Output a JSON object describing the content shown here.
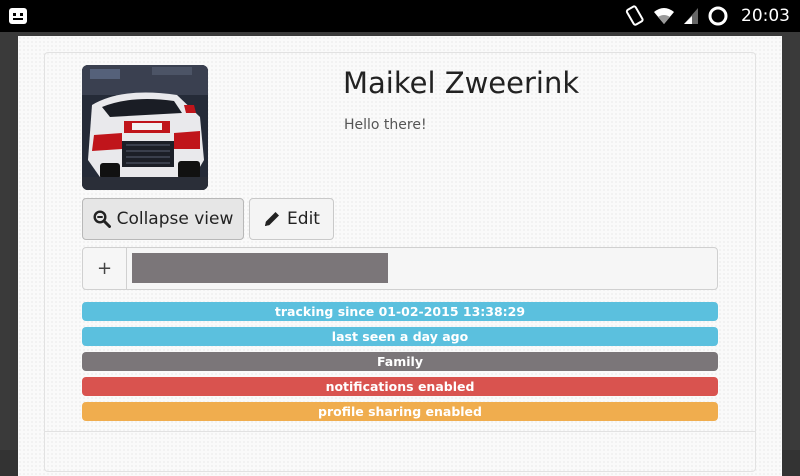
{
  "status_bar": {
    "time": "20:03",
    "icons": [
      "app-notification-icon",
      "rotate-phone-icon",
      "wifi-icon",
      "signal-icon",
      "battery-ring-icon"
    ]
  },
  "profile": {
    "name": "Maikel Zweerink",
    "greeting": "Hello there!",
    "avatar_description": "race-car-photo"
  },
  "actions": {
    "collapse_label": "Collapse view",
    "collapse_icon": "zoom-out-icon",
    "edit_label": "Edit",
    "edit_icon": "pencil-icon"
  },
  "input_group": {
    "addon_label": "+",
    "progress_fraction": 0.44,
    "progress_color": "#7b7679"
  },
  "badges": [
    {
      "text": "tracking since 01-02-2015 13:38:29",
      "color": "#5bc0de"
    },
    {
      "text": "last seen a day ago",
      "color": "#5bc0de"
    },
    {
      "text": "Family",
      "color": "#7b7679"
    },
    {
      "text": "notifications enabled",
      "color": "#d9534f"
    },
    {
      "text": "profile sharing enabled",
      "color": "#f0ad4e"
    }
  ]
}
